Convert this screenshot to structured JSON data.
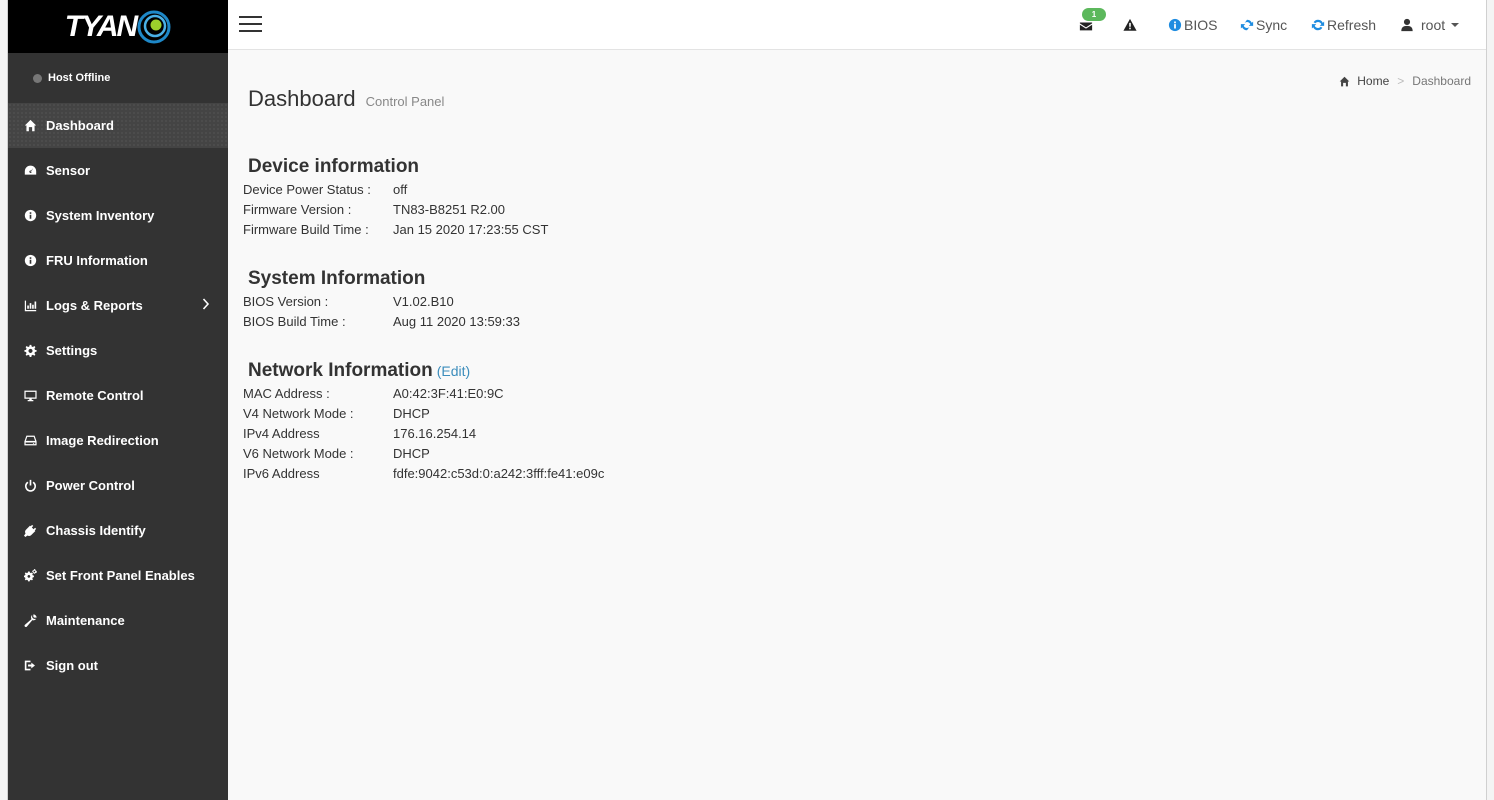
{
  "brand": {
    "logo_text": "TYAN"
  },
  "host": {
    "status_text": "Host Offline"
  },
  "sidebar": {
    "items": [
      {
        "label": "Dashboard",
        "icon": "home-icon",
        "active": true
      },
      {
        "label": "Sensor",
        "icon": "dashboard-gauge-icon"
      },
      {
        "label": "System Inventory",
        "icon": "info-circle-icon"
      },
      {
        "label": "FRU Information",
        "icon": "info-circle-icon"
      },
      {
        "label": "Logs & Reports",
        "icon": "bar-chart-icon",
        "has_submenu": true
      },
      {
        "label": "Settings",
        "icon": "gear-icon"
      },
      {
        "label": "Remote Control",
        "icon": "monitor-icon"
      },
      {
        "label": "Image Redirection",
        "icon": "hard-drive-icon"
      },
      {
        "label": "Power Control",
        "icon": "power-icon"
      },
      {
        "label": "Chassis Identify",
        "icon": "plug-icon"
      },
      {
        "label": "Set Front Panel Enables",
        "icon": "gears-icon"
      },
      {
        "label": "Maintenance",
        "icon": "wrench-icon"
      },
      {
        "label": "Sign out",
        "icon": "sign-out-icon"
      }
    ]
  },
  "topbar": {
    "messages_count": "1",
    "bios_label": "BIOS",
    "sync_label": "Sync",
    "refresh_label": "Refresh",
    "user_label": "root"
  },
  "page": {
    "title": "Dashboard",
    "subtitle": "Control Panel",
    "breadcrumb": {
      "home": "Home",
      "current": "Dashboard"
    }
  },
  "device_info": {
    "heading": "Device information",
    "rows": [
      {
        "key": "Device Power Status :",
        "value": "off"
      },
      {
        "key": "Firmware Version :",
        "value": "TN83-B8251 R2.00"
      },
      {
        "key": "Firmware Build Time :",
        "value": "Jan 15 2020 17:23:55 CST"
      }
    ]
  },
  "system_info": {
    "heading": "System Information",
    "rows": [
      {
        "key": "BIOS Version :",
        "value": "V1.02.B10"
      },
      {
        "key": "BIOS Build Time :",
        "value": "Aug 11 2020 13:59:33"
      }
    ]
  },
  "network_info": {
    "heading": "Network Information",
    "edit_label": "(Edit)",
    "rows": [
      {
        "key": "MAC Address :",
        "value": "A0:42:3F:41:E0:9C"
      },
      {
        "key": "V4 Network Mode :",
        "value": "DHCP"
      },
      {
        "key": "IPv4 Address",
        "value": "176.16.254.14"
      },
      {
        "key": "V6 Network Mode :",
        "value": "DHCP"
      },
      {
        "key": "IPv6 Address",
        "value": "fdfe:9042:c53d:0:a242:3fff:fe41:e09c"
      }
    ]
  },
  "colors": {
    "sidebar_bg": "#333333",
    "accent": "#3c8dbc",
    "badge": "#5cb85c"
  }
}
